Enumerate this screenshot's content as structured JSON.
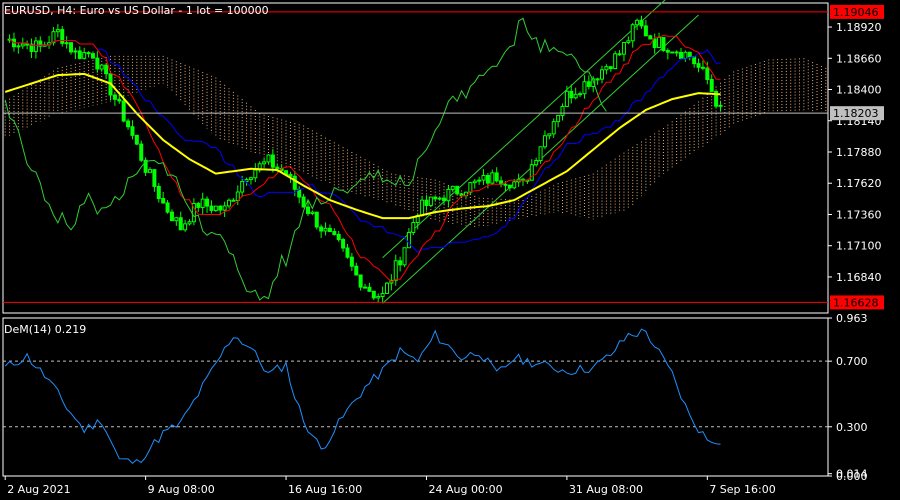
{
  "header": {
    "title": "EURUSD, H4:  Euro vs US Dollar - 1 lot = 100000"
  },
  "indicator": {
    "label": "DeM(14) 0.219"
  },
  "colors": {
    "background": "#000000",
    "frame": "#ffffff",
    "candle": "#00ff00",
    "ma": "#ffff00",
    "tenkan": "#ff0000",
    "kijun": "#0000ff",
    "chikou": "#32cd32",
    "cloud_a": "#f4a460",
    "cloud_b": "#d2b48c",
    "channel": "#32cd32",
    "dem_line": "#1e90ff",
    "level_line": "#ff0000",
    "bid_line": "#c0c0c0",
    "badge_red": "#ff0000",
    "badge_gray": "#c0c0c0"
  },
  "chart_data": [
    {
      "type": "candlestick",
      "symbol": "EURUSD",
      "timeframe": "H4",
      "title": "EURUSD, H4:  Euro vs US Dollar - 1 lot = 100000",
      "ylim": [
        1.1654,
        1.1912
      ],
      "price_ticks": [
        "1.18920",
        "1.18660",
        "1.18400",
        "1.18140",
        "1.17880",
        "1.17620",
        "1.17360",
        "1.17100",
        "1.16840"
      ],
      "price_tick_values": [
        1.1892,
        1.1866,
        1.184,
        1.1814,
        1.1788,
        1.1762,
        1.1736,
        1.171,
        1.1684
      ],
      "levels": [
        {
          "label": "1.19046",
          "value": 1.19046,
          "style": "red"
        },
        {
          "label": "1.18203",
          "value": 1.18203,
          "style": "gray"
        },
        {
          "label": "1.16628",
          "value": 1.16628,
          "style": "red"
        }
      ],
      "time_ticks": [
        "2 Aug 2021",
        "9 Aug 08:00",
        "16 Aug 16:00",
        "24 Aug 00:00",
        "31 Aug 08:00",
        "7 Sep 16:00"
      ],
      "close_anchors": [
        [
          0,
          1.1882
        ],
        [
          8,
          1.1875
        ],
        [
          12,
          1.1888
        ],
        [
          16,
          1.187
        ],
        [
          20,
          1.187
        ],
        [
          24,
          1.184
        ],
        [
          28,
          1.181
        ],
        [
          32,
          1.1775
        ],
        [
          36,
          1.1745
        ],
        [
          40,
          1.1725
        ],
        [
          44,
          1.1745
        ],
        [
          50,
          1.174
        ],
        [
          55,
          1.177
        ],
        [
          60,
          1.178
        ],
        [
          64,
          1.177
        ],
        [
          68,
          1.1745
        ],
        [
          72,
          1.1725
        ],
        [
          76,
          1.171
        ],
        [
          80,
          1.1685
        ],
        [
          84,
          1.167
        ],
        [
          86,
          1.1668
        ],
        [
          90,
          1.17
        ],
        [
          94,
          1.174
        ],
        [
          100,
          1.1752
        ],
        [
          106,
          1.176
        ],
        [
          112,
          1.1768
        ],
        [
          118,
          1.176
        ],
        [
          122,
          1.1795
        ],
        [
          128,
          1.1835
        ],
        [
          134,
          1.185
        ],
        [
          140,
          1.187
        ],
        [
          144,
          1.1895
        ],
        [
          148,
          1.188
        ],
        [
          152,
          1.1875
        ],
        [
          156,
          1.1868
        ],
        [
          160,
          1.1848
        ],
        [
          163,
          1.1822
        ]
      ],
      "ma_anchors": [
        [
          0,
          1.1838
        ],
        [
          6,
          1.1845
        ],
        [
          12,
          1.1852
        ],
        [
          18,
          1.1853
        ],
        [
          24,
          1.1845
        ],
        [
          30,
          1.182
        ],
        [
          36,
          1.1798
        ],
        [
          42,
          1.1782
        ],
        [
          48,
          1.177
        ],
        [
          56,
          1.1774
        ],
        [
          62,
          1.1773
        ],
        [
          68,
          1.176
        ],
        [
          74,
          1.1748
        ],
        [
          80,
          1.174
        ],
        [
          86,
          1.1733
        ],
        [
          92,
          1.1733
        ],
        [
          98,
          1.1738
        ],
        [
          104,
          1.1741
        ],
        [
          110,
          1.1743
        ],
        [
          116,
          1.1748
        ],
        [
          122,
          1.176
        ],
        [
          128,
          1.1772
        ],
        [
          134,
          1.179
        ],
        [
          140,
          1.1808
        ],
        [
          146,
          1.1823
        ],
        [
          152,
          1.1832
        ],
        [
          158,
          1.1837
        ],
        [
          163,
          1.1836
        ]
      ],
      "cloud_anchors": [
        [
          0,
          1.18,
          1.183
        ],
        [
          12,
          1.182,
          1.1858
        ],
        [
          24,
          1.183,
          1.1868
        ],
        [
          36,
          1.1845,
          1.1868
        ],
        [
          48,
          1.18,
          1.185
        ],
        [
          58,
          1.1785,
          1.182
        ],
        [
          68,
          1.177,
          1.181
        ],
        [
          78,
          1.1755,
          1.179
        ],
        [
          88,
          1.1745,
          1.177
        ],
        [
          98,
          1.173,
          1.1765
        ],
        [
          108,
          1.1725,
          1.175
        ],
        [
          118,
          1.1733,
          1.1748
        ],
        [
          126,
          1.1738,
          1.1762
        ],
        [
          134,
          1.1732,
          1.177
        ],
        [
          142,
          1.174,
          1.179
        ],
        [
          150,
          1.177,
          1.1808
        ],
        [
          158,
          1.179,
          1.183
        ],
        [
          166,
          1.181,
          1.1855
        ],
        [
          174,
          1.1822,
          1.1865
        ],
        [
          182,
          1.1822,
          1.1866
        ],
        [
          187,
          1.1822,
          1.1858
        ]
      ],
      "channel": {
        "from": [
          86,
          1.1662
        ],
        "to": [
          158,
          1.1902
        ],
        "offset": -0.0038
      }
    },
    {
      "type": "line",
      "name": "DeM(14)",
      "label": "DeM(14) 0.219",
      "ylim": [
        0,
        0.963
      ],
      "ticks": [
        "0.963",
        "0.700",
        "0.300",
        "0.014",
        "0.000"
      ],
      "tick_values": [
        0.963,
        0.7,
        0.3,
        0.014,
        0.0
      ],
      "levels": [
        0.7,
        0.3
      ],
      "anchors": [
        [
          0,
          0.66
        ],
        [
          5,
          0.73
        ],
        [
          10,
          0.58
        ],
        [
          14,
          0.42
        ],
        [
          18,
          0.28
        ],
        [
          22,
          0.34
        ],
        [
          26,
          0.1
        ],
        [
          30,
          0.08
        ],
        [
          36,
          0.26
        ],
        [
          40,
          0.32
        ],
        [
          44,
          0.5
        ],
        [
          48,
          0.68
        ],
        [
          52,
          0.86
        ],
        [
          56,
          0.78
        ],
        [
          60,
          0.62
        ],
        [
          64,
          0.68
        ],
        [
          66,
          0.48
        ],
        [
          68,
          0.34
        ],
        [
          72,
          0.16
        ],
        [
          74,
          0.24
        ],
        [
          78,
          0.4
        ],
        [
          82,
          0.54
        ],
        [
          86,
          0.64
        ],
        [
          90,
          0.76
        ],
        [
          94,
          0.7
        ],
        [
          98,
          0.86
        ],
        [
          104,
          0.72
        ],
        [
          108,
          0.76
        ],
        [
          112,
          0.62
        ],
        [
          116,
          0.72
        ],
        [
          122,
          0.68
        ],
        [
          128,
          0.64
        ],
        [
          134,
          0.66
        ],
        [
          138,
          0.74
        ],
        [
          142,
          0.86
        ],
        [
          146,
          0.88
        ],
        [
          152,
          0.62
        ],
        [
          156,
          0.36
        ],
        [
          160,
          0.22
        ],
        [
          163,
          0.219
        ]
      ]
    }
  ]
}
